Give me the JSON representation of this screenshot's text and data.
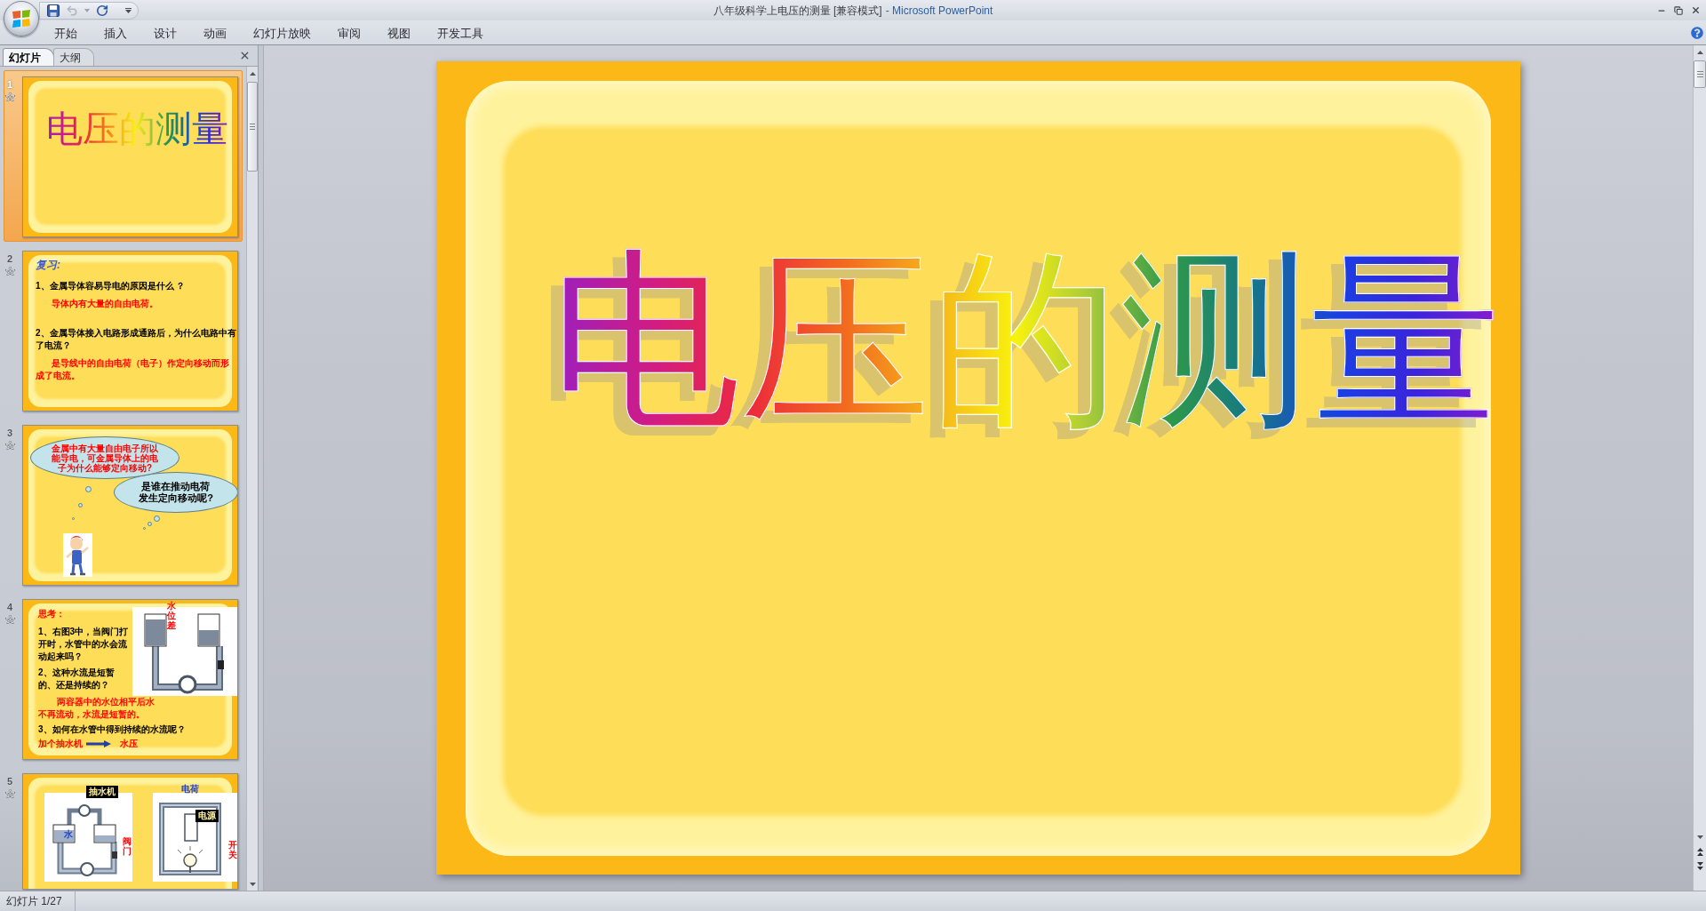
{
  "window": {
    "title": "八年级科学上电压的测量 [兼容模式]",
    "app_name": "- Microsoft PowerPoint"
  },
  "quick_access": [
    {
      "kind": "save",
      "disabled": false
    },
    {
      "kind": "undo",
      "disabled": true
    },
    {
      "kind": "repeat",
      "disabled": false
    }
  ],
  "ribbon_tabs": [
    {
      "label": "开始",
      "selected": false
    },
    {
      "label": "插入",
      "selected": false
    },
    {
      "label": "设计",
      "selected": false
    },
    {
      "label": "动画",
      "selected": false
    },
    {
      "label": "幻灯片放映",
      "selected": false
    },
    {
      "label": "审阅",
      "selected": false
    },
    {
      "label": "视图",
      "selected": false
    },
    {
      "label": "开发工具",
      "selected": false
    }
  ],
  "pane_tabs": [
    {
      "label": "幻灯片",
      "selected": true
    },
    {
      "label": "大纲",
      "selected": false
    }
  ],
  "thumbnails": [
    {
      "number": "1",
      "selected": true,
      "kind": "title",
      "title": "电压的测量"
    },
    {
      "number": "2",
      "selected": false,
      "kind": "review",
      "heading": "复习:",
      "items": [
        {
          "kind": "question",
          "text": "1、金属导体容易导电的原因是什么 ？"
        },
        {
          "kind": "answer",
          "text": "导体内有大量的自由电荷。"
        },
        {
          "kind": "question",
          "text": "2、金属导体接入电路形成通路后，为什么电路中有了电流？"
        },
        {
          "kind": "answer",
          "text": "是导线中的自由电荷（电子）作定向移动而形成了电流。"
        }
      ]
    },
    {
      "number": "3",
      "selected": false,
      "kind": "clouds",
      "clouds": [
        {
          "kind": "detail",
          "lines": [
            "金属中有大量自由电子所以",
            "能导电，可金属导体上的电",
            "子为什么能够定向移动?"
          ]
        },
        {
          "kind": "prompt",
          "lines": [
            "是谁在推动电荷",
            "发生定向移动呢?"
          ]
        }
      ]
    },
    {
      "number": "4",
      "selected": false,
      "kind": "thinking",
      "heading": "思考：",
      "figure_label": "水位差",
      "items": [
        {
          "kind": "question",
          "text": "1、右图3中，当阀门打开时，水管中的水会流动起来吗？"
        },
        {
          "kind": "question",
          "text": "2、这种水流是短暂的、还是持续的？"
        },
        {
          "kind": "answer",
          "text": "两容器中的水位相平后水不再流动，水流是短暂的。"
        },
        {
          "kind": "question",
          "text": "3、如何在水管中得到持续的水流呢？"
        }
      ],
      "result": {
        "cause": "加个抽水机",
        "effect": "水压"
      }
    },
    {
      "number": "5",
      "selected": false,
      "kind": "diagrams",
      "labels": [
        {
          "kind": "tag",
          "text": "抽水机"
        },
        {
          "kind": "note",
          "text": "水"
        },
        {
          "kind": "vertical",
          "text": "阀门"
        },
        {
          "kind": "note",
          "text": "电荷"
        },
        {
          "kind": "tag",
          "text": "电源"
        },
        {
          "kind": "vertical",
          "text": "开关"
        }
      ]
    }
  ],
  "slide": {
    "title": "电压的测量"
  },
  "status_bar": {
    "slide_counter": "幻灯片 1/27"
  }
}
